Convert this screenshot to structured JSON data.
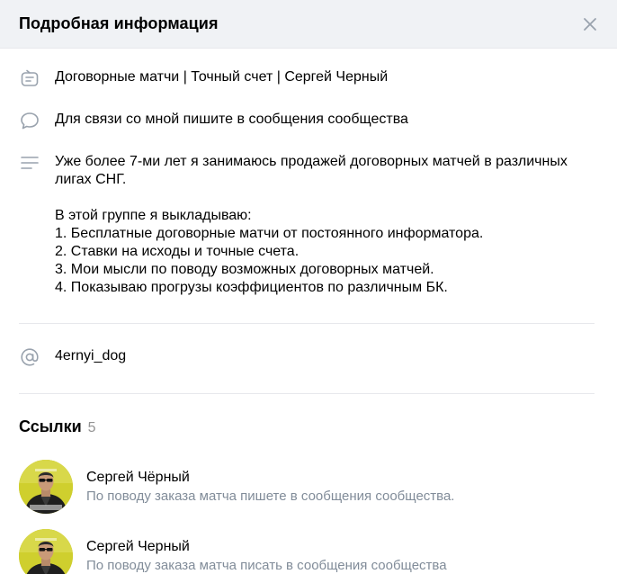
{
  "header": {
    "title": "Подробная информация"
  },
  "info": {
    "status": "Договорные матчи | Точный счет | Сергей Черный",
    "contact": "Для связи со мной пишите в сообщения сообщества",
    "description": {
      "intro_line1": "Уже более 7-ми лет я занимаюсь продажей договорных матчей в различных",
      "intro_line2": "лигах СНГ.",
      "list_title": "В этой группе я выкладываю:",
      "item1": "1. Бесплатные договорные матчи от постоянного информатора.",
      "item2": "2. Ставки на исходы и точные счета.",
      "item3": "3. Мои мысли по поводу возможных договорных матчей.",
      "item4": "4. Показываю прогрузы коэффициентов по различным БК."
    },
    "alias": "4ernyi_dog"
  },
  "links": {
    "title": "Ссылки",
    "count": "5",
    "items": [
      {
        "name": "Сергей Чёрный",
        "description": "По поводу заказа матча пишете в сообщения сообщества."
      },
      {
        "name": "Сергей Черный",
        "description": "По поводу заказа матча писать в сообщения сообщества"
      }
    ]
  },
  "colors": {
    "header_bg": "#f0f2f5",
    "icon": "#99a2ad",
    "secondary_text": "#818c99",
    "divider": "#e7e8ec"
  },
  "icons": {
    "close": "close-icon",
    "status": "status-icon",
    "contact": "message-icon",
    "description": "text-lines-icon",
    "alias": "at-sign-icon"
  }
}
